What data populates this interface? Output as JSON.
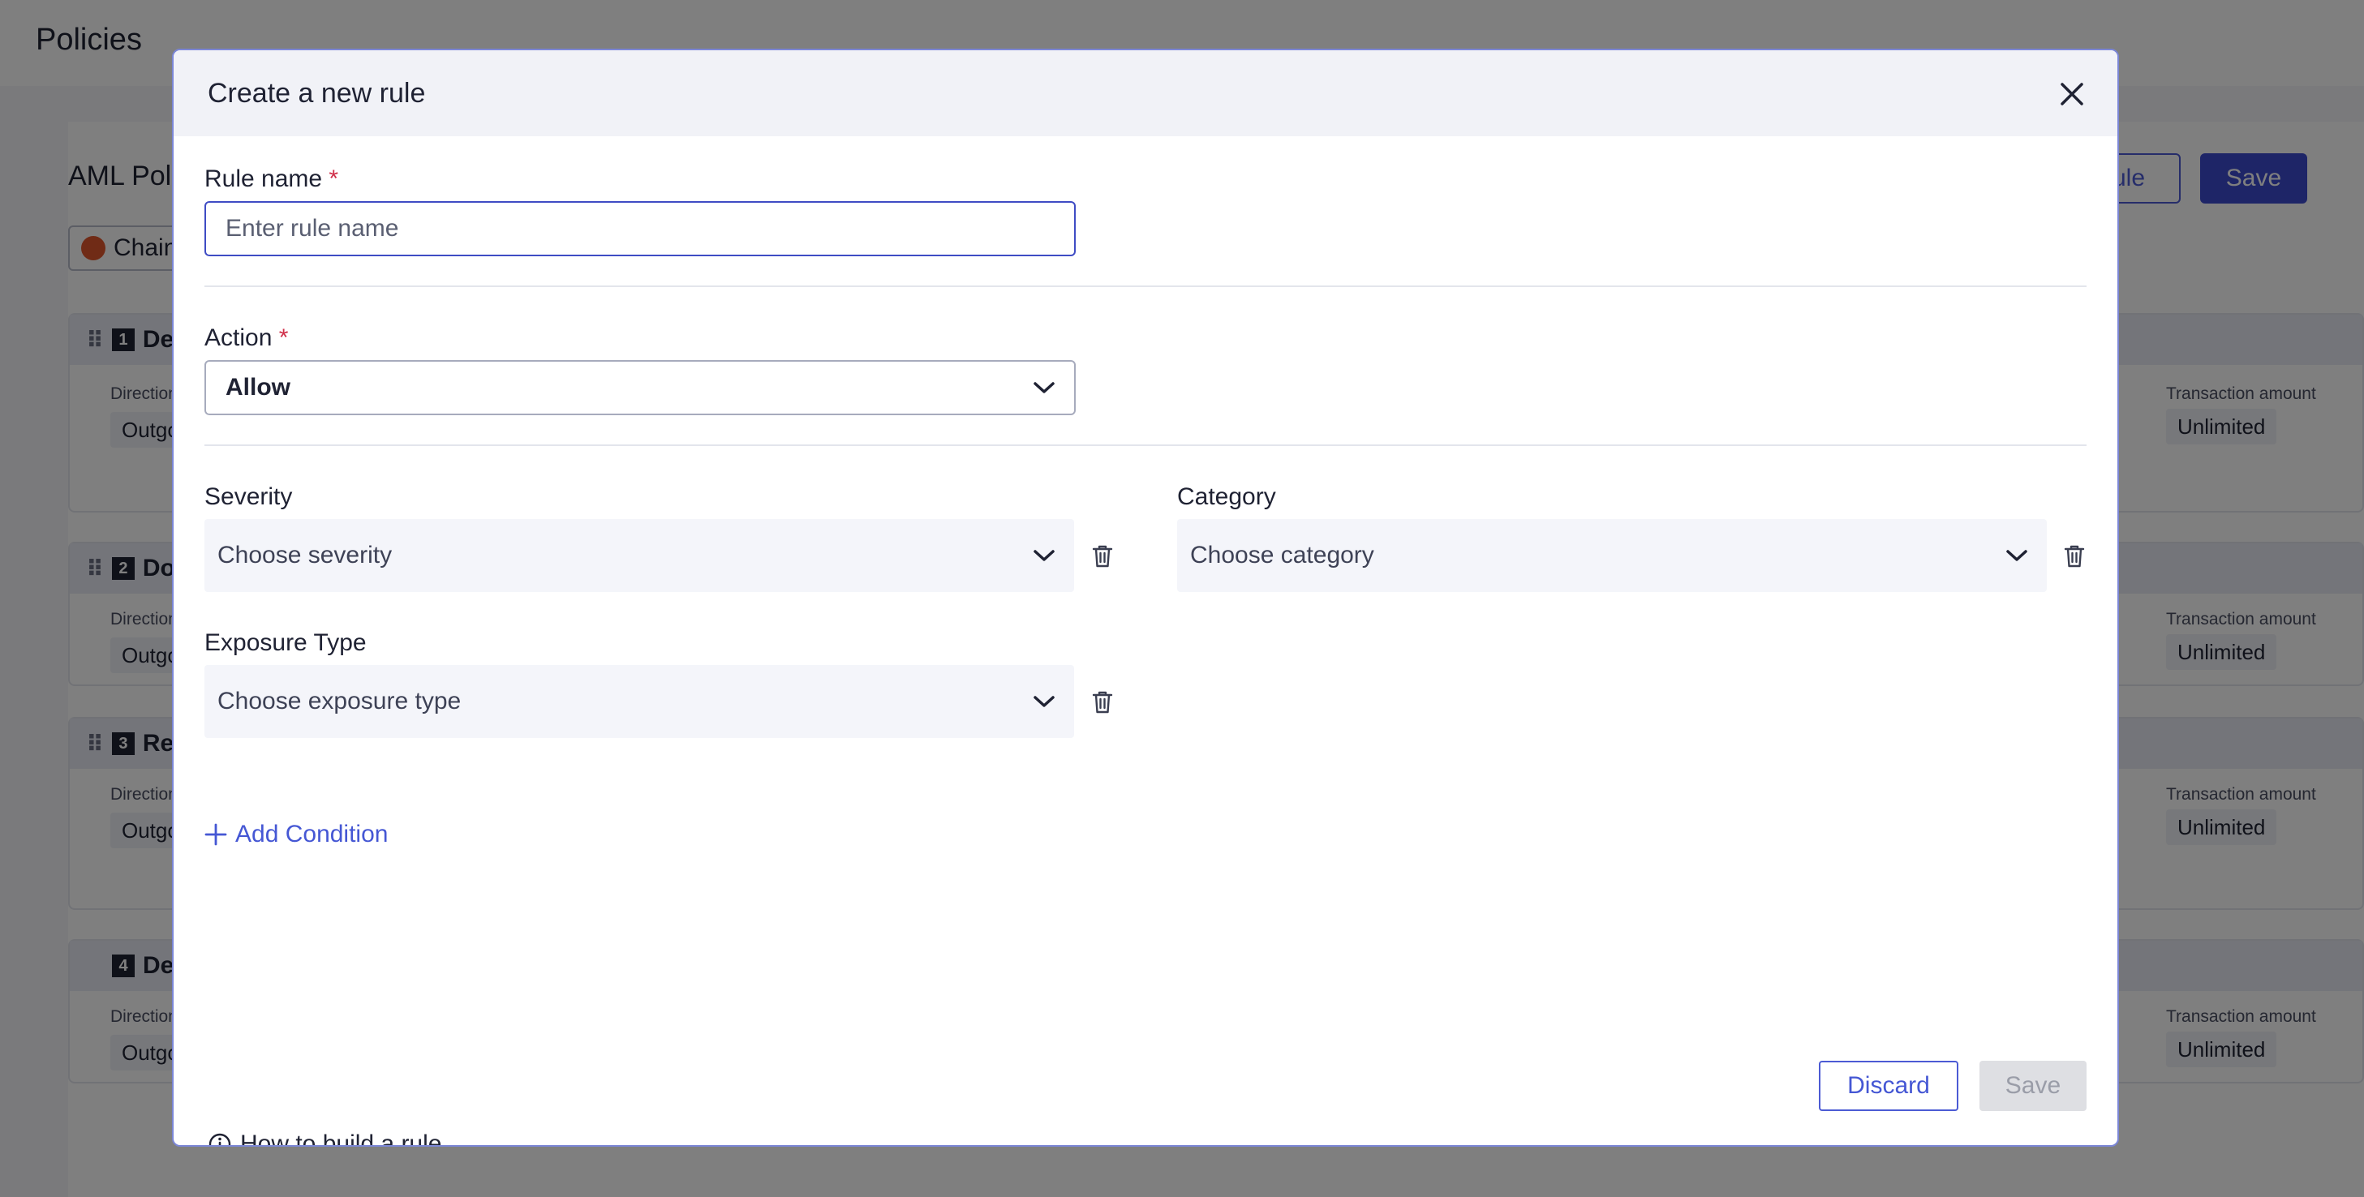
{
  "background": {
    "page_title": "Policies",
    "policy_title": "AML Pol",
    "chip_label": "Chain",
    "top_buttons": {
      "secondary_label": "ule",
      "primary_label": "Save"
    },
    "rules": [
      {
        "number": "1",
        "title": "De",
        "direction_label": "Direction",
        "direction_value": "Outgo",
        "amount_label": "Transaction amount",
        "amount_value": "Unlimited"
      },
      {
        "number": "2",
        "title": "Do",
        "direction_label": "Direction",
        "direction_value": "Outgo",
        "amount_label": "Transaction amount",
        "amount_value": "Unlimited"
      },
      {
        "number": "3",
        "title": "Re",
        "direction_label": "Direction",
        "direction_value": "Outgo",
        "amount_label": "Transaction amount",
        "amount_value": "Unlimited"
      },
      {
        "number": "4",
        "title": "De",
        "direction_label": "Direction",
        "direction_value": "Outgo",
        "amount_label": "Transaction amount",
        "amount_value": "Unlimited"
      }
    ]
  },
  "modal": {
    "title": "Create a new rule",
    "rule_name": {
      "label": "Rule name",
      "required_mark": "*",
      "placeholder": "Enter rule name",
      "value": ""
    },
    "action": {
      "label": "Action",
      "required_mark": "*",
      "selected": "Allow"
    },
    "severity": {
      "label": "Severity",
      "placeholder": "Choose severity"
    },
    "category": {
      "label": "Category",
      "placeholder": "Choose category"
    },
    "exposure_type": {
      "label": "Exposure Type",
      "placeholder": "Choose exposure type"
    },
    "add_condition_label": "Add Condition",
    "help_link_label": "How to build a rule",
    "discard_label": "Discard",
    "save_label": "Save"
  },
  "colors": {
    "accent": "#4557d4",
    "focus_border": "#3f4cc4",
    "required": "#d0304a",
    "disabled_bg": "#dedfe3"
  }
}
